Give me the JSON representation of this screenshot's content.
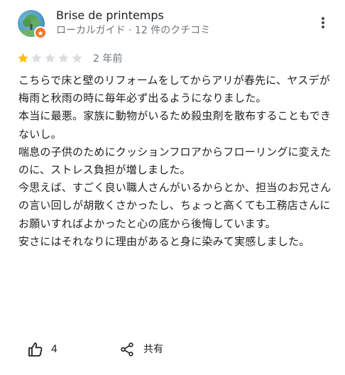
{
  "author": {
    "name": "Brise de printemps",
    "meta": "ローカルガイド · 12 件のクチコミ"
  },
  "rating": {
    "value": 1,
    "max": 5,
    "filled_color": "#fbbc04",
    "empty_color": "#dadce0"
  },
  "review": {
    "date": "2 年前",
    "paragraphs": [
      "こちらで床と壁のリフォームをしてからアリが春先に、ヤスデが梅雨と秋雨の時に毎年必ず出るようになりました。",
      "本当に最悪。家族に動物がいるため殺虫剤を散布することもできないし。",
      "喘息の子供のためにクッションフロアからフローリングに変えたのに、ストレス負担が増しました。",
      "今思えば、すごく良い職人さんがいるからとか、担当のお兄さんの言い回しが胡散くさかったし、ちょっと高くても工務店さんにお願いすればよかったと心の底から後悔しています。",
      "安さにはそれなりに理由があると身に染みて実感しました。"
    ]
  },
  "actions": {
    "like_count": "4",
    "share_label": "共有"
  },
  "icons": {
    "more": "more-vert-icon",
    "like": "thumb-up-icon",
    "share": "share-icon",
    "badge": "local-guide-badge-icon"
  },
  "colors": {
    "primary_text": "#202124",
    "secondary_text": "#70757a",
    "badge": "#f4742c"
  }
}
